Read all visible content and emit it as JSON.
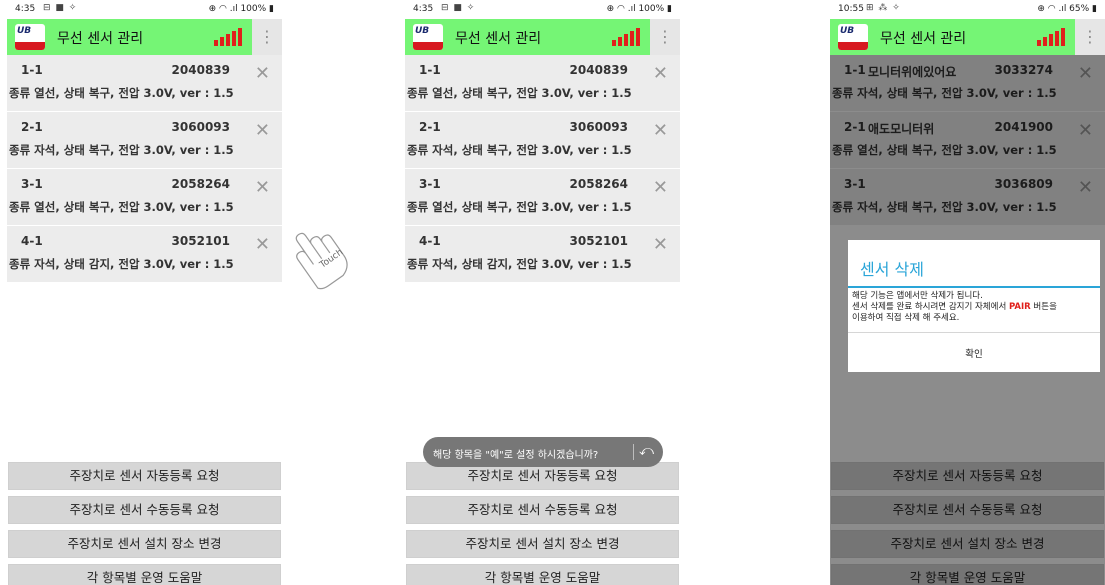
{
  "screens": [
    {
      "status": {
        "time": "4:35",
        "left_icons": "⊟ ■ ✧",
        "right": "⊕ ◠ .ıl 100% ▮"
      },
      "app": {
        "title": "무선 센서 관리",
        "logo_text": "UB",
        "kebab": "⋮"
      },
      "sensors": [
        {
          "id": "1-1",
          "code": "2040839",
          "desc": "종류 열선, 상태 복구, 전압 3.0V, ver : 1.5"
        },
        {
          "id": "2-1",
          "code": "3060093",
          "desc": "종류 자석, 상태 복구, 전압 3.0V, ver : 1.5"
        },
        {
          "id": "3-1",
          "code": "2058264",
          "desc": "종류 열선, 상태 복구, 전압 3.0V, ver : 1.5"
        },
        {
          "id": "4-1",
          "code": "3052101",
          "desc": "종류 자석, 상태 감지, 전압 3.0V, ver : 1.5"
        }
      ],
      "touch_label": "Touch"
    },
    {
      "status": {
        "time": "4:35",
        "left_icons": "⊟ ■ ✧",
        "right": "⊕ ◠ .ıl 100% ▮"
      },
      "app": {
        "title": "무선 센서 관리",
        "logo_text": "UB",
        "kebab": "⋮"
      },
      "sensors": [
        {
          "id": "1-1",
          "code": "2040839",
          "desc": "종류 열선, 상태 복구, 전압 3.0V, ver : 1.5"
        },
        {
          "id": "2-1",
          "code": "3060093",
          "desc": "종류 자석, 상태 복구, 전압 3.0V, ver : 1.5"
        },
        {
          "id": "3-1",
          "code": "2058264",
          "desc": "종류 열선, 상태 복구, 전압 3.0V, ver : 1.5"
        },
        {
          "id": "4-1",
          "code": "3052101",
          "desc": "종류 자석, 상태 감지, 전압 3.0V, ver : 1.5"
        }
      ],
      "toast": "해당 항목을 \"예\"로 설정 하시겠습니까?"
    },
    {
      "status": {
        "time": "10:55",
        "left_icons": "⊞ ⁂ ✧",
        "right": "⊕ ◠ .ıl 65% ▮"
      },
      "app": {
        "title": "무선 센서 관리",
        "logo_text": "UB",
        "kebab": "⋮"
      },
      "sensors": [
        {
          "id": "1-1",
          "name": "모니터위에있어요",
          "code": "3033274",
          "desc": "종류 자석, 상태 복구, 전압 3.0V, ver : 1.5"
        },
        {
          "id": "2-1",
          "name": "애도모니터위",
          "code": "2041900",
          "desc": "종류 열선, 상태 복구, 전압 3.0V, ver : 1.5"
        },
        {
          "id": "3-1",
          "code": "3036809",
          "desc": "종류 자석, 상태 복구, 전압 3.0V, ver : 1.5"
        }
      ],
      "dialog": {
        "title": "센서 삭제",
        "line1": "해당 기능은 앱에서만 삭제가 됩니다.",
        "line2_pre": "센서 삭제를 완료 하시려면 감지기 자체에서 ",
        "line2_strong": "PAIR",
        "line2_post": " 버튼을",
        "line3": "이용하여 직접 삭제 해 주세요.",
        "confirm": "확인"
      }
    }
  ],
  "buttons": {
    "auto_register": "주장치로 센서 자동등록 요청",
    "manual_register": "주장치로 센서 수동등록 요청",
    "change_location": "주장치로 센서 설치 장소 변경",
    "help": "각 항목별 운영 도움말"
  },
  "icons": {
    "delete": "close-x-icon",
    "undo": "undo-icon",
    "hand": "touch-hand-icon"
  },
  "colors": {
    "appbar": "#75f575",
    "dialog_accent": "#2aa5d8",
    "pair_red": "#e0201b",
    "signal_red": "#e0201b"
  }
}
